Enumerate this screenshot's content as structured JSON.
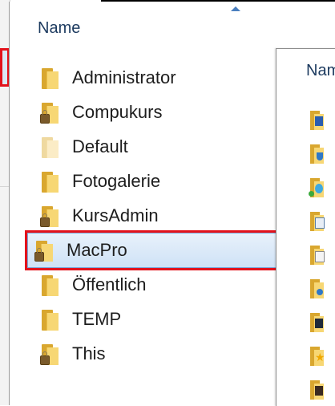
{
  "main": {
    "column_header": "Name",
    "rows": [
      {
        "label": "Administrator",
        "icon": "folder-icon"
      },
      {
        "label": "Compukurs",
        "icon": "locked-folder-icon"
      },
      {
        "label": "Default",
        "icon": "folder-icon"
      },
      {
        "label": "Fotogalerie",
        "icon": "folder-icon"
      },
      {
        "label": "KursAdmin",
        "icon": "locked-folder-icon"
      },
      {
        "label": "MacPro",
        "icon": "locked-folder-icon",
        "selected": true
      },
      {
        "label": "Öffentlich",
        "icon": "folder-icon"
      },
      {
        "label": "TEMP",
        "icon": "folder-icon"
      },
      {
        "label": "This",
        "icon": "locked-folder-icon"
      }
    ]
  },
  "right_panel": {
    "column_header": "Name",
    "icons": [
      "desktop-folder-icon",
      "downloads-folder-icon",
      "network-folder-icon",
      "documents-folder-icon",
      "templates-folder-icon",
      "music-folder-icon",
      "videos-folder-icon",
      "favorites-folder-icon",
      "pictures-folder-icon"
    ]
  },
  "colors": {
    "selection_outline": "#e3121b",
    "selection_fill": "#cfe2f6",
    "header_text": "#1c3a5f",
    "folder_yellow": "#f7d774"
  }
}
